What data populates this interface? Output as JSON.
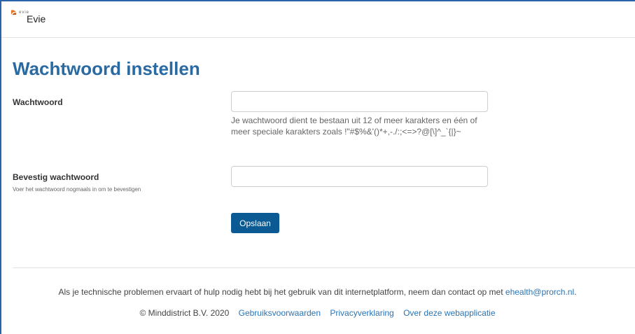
{
  "header": {
    "logo_text": "evie",
    "app_title": "Evie",
    "brand_color": "#e07a2a"
  },
  "main": {
    "title": "Wachtwoord instellen",
    "password": {
      "label": "Wachtwoord",
      "value": "",
      "help": "Je wachtwoord dient te bestaan uit 12 of meer karakters en één of meer speciale karakters zoals !\"#$%&'()*+,-./:;<=>?@[\\]^_`{|}~"
    },
    "confirm": {
      "label": "Bevestig wachtwoord",
      "sublabel": "Voer het wachtwoord nogmaals in om te bevestigen",
      "value": ""
    },
    "save_label": "Opslaan"
  },
  "footer": {
    "support_text": "Als je technische problemen ervaart of hulp nodig hebt bij het gebruik van dit internetplatform, neem dan contact op met",
    "support_email": "ehealth@prorch.nl",
    "support_suffix": ".",
    "copyright": "© Minddistrict B.V. 2020",
    "links": {
      "terms": "Gebruiksvoorwaarden",
      "privacy": "Privacyverklaring",
      "about": "Over deze webapplicatie"
    }
  },
  "colors": {
    "accent": "#2a6aa3",
    "button": "#0c5a94",
    "link": "#2a74b5"
  }
}
